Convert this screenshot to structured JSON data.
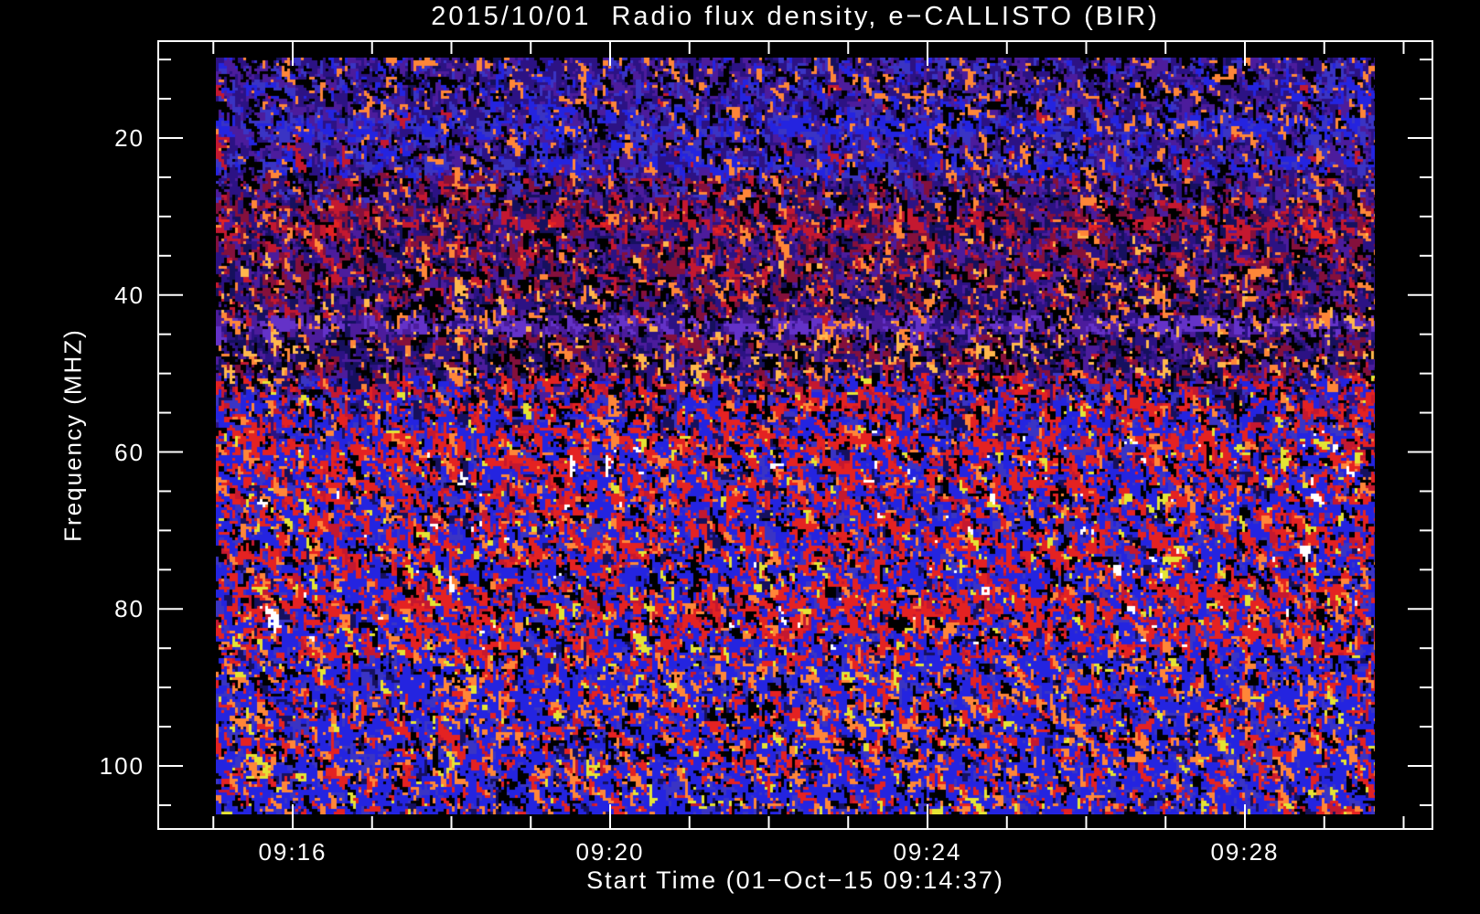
{
  "title": "2015/10/01  Radio flux density, e−CALLISTO (BIR)",
  "colors": {
    "background": "#000000",
    "foreground": "#ffffff"
  },
  "chart_data": {
    "type": "heatmap",
    "subtype": "radio-spectrogram",
    "title": "2015/10/01  Radio flux density, e−CALLISTO (BIR)",
    "xlabel": "Start Time (01−Oct−15 09:14:37)",
    "ylabel": "Frequency (MHZ)",
    "instrument": "e−CALLISTO (BIR)",
    "date": "2015/10/01",
    "start_time": "09:14:37",
    "x_ticks": [
      {
        "label": "09:16",
        "minute": 0
      },
      {
        "label": "09:20",
        "minute": 4
      },
      {
        "label": "09:24",
        "minute": 8
      },
      {
        "label": "09:28",
        "minute": 12
      }
    ],
    "x_minor_step_minutes": 1,
    "x_axis_range": [
      "09:14:18",
      "09:30:22"
    ],
    "y_ticks": [
      20,
      40,
      60,
      80,
      100
    ],
    "y_minor_step_mhz": 5,
    "y_axis_range_mhz": [
      7.5,
      108.1
    ],
    "y_axis_inverted": true,
    "grid": false,
    "legend": "none",
    "palette": {
      "K": "#000000",
      "NB": "#16105e",
      "IN": "#2c1284",
      "PU": "#4c1c9c",
      "VI": "#6432c8",
      "BL": "#2424e0",
      "MB": "#3a34c4",
      "MA": "#84103c",
      "CR": "#c41830",
      "RD": "#e42222",
      "OR": "#ff8638",
      "OY": "#ffb84c",
      "YL": "#e4e434",
      "WH": "#ffffff"
    },
    "noise_bands": [
      {
        "f0": 9.0,
        "f1": 13.0,
        "w": {
          "K": 20,
          "IN": 30,
          "PU": 20,
          "MB": 12,
          "BL": 8,
          "OR": 8,
          "NB": 2
        }
      },
      {
        "f0": 13.0,
        "f1": 17.0,
        "w": {
          "K": 18,
          "IN": 26,
          "PU": 18,
          "MB": 12,
          "BL": 14,
          "OR": 8,
          "CR": 2,
          "NB": 2
        }
      },
      {
        "f0": 17.0,
        "f1": 19.5,
        "w": {
          "K": 14,
          "IN": 16,
          "PU": 10,
          "MB": 18,
          "BL": 32,
          "OR": 8,
          "NB": 2
        }
      },
      {
        "f0": 19.5,
        "f1": 22.5,
        "w": {
          "K": 18,
          "IN": 24,
          "PU": 20,
          "MB": 12,
          "BL": 12,
          "OR": 8,
          "CR": 4,
          "NB": 2
        }
      },
      {
        "f0": 22.5,
        "f1": 24.5,
        "w": {
          "K": 14,
          "IN": 18,
          "PU": 12,
          "MB": 16,
          "BL": 28,
          "OR": 8,
          "CR": 2,
          "NB": 2
        }
      },
      {
        "f0": 24.5,
        "f1": 28.0,
        "w": {
          "K": 18,
          "IN": 22,
          "PU": 18,
          "MA": 12,
          "CR": 6,
          "MB": 8,
          "OR": 8,
          "NB": 8
        }
      },
      {
        "f0": 28.0,
        "f1": 30.5,
        "w": {
          "K": 16,
          "MA": 20,
          "CR": 14,
          "IN": 18,
          "PU": 14,
          "NB": 8,
          "OR": 8,
          "MB": 2
        }
      },
      {
        "f0": 30.5,
        "f1": 31.8,
        "w": {
          "K": 8,
          "CR": 30,
          "RD": 6,
          "NB": 24,
          "IN": 12,
          "MA": 8,
          "OR": 8,
          "PU": 4
        }
      },
      {
        "f0": 31.8,
        "f1": 38.0,
        "w": {
          "K": 16,
          "NB": 12,
          "IN": 16,
          "PU": 18,
          "MA": 18,
          "CR": 10,
          "OR": 8,
          "OY": 2
        }
      },
      {
        "f0": 38.0,
        "f1": 42.5,
        "w": {
          "K": 20,
          "NB": 16,
          "IN": 18,
          "PU": 16,
          "MA": 14,
          "CR": 6,
          "OR": 8,
          "OY": 2
        }
      },
      {
        "f0": 42.5,
        "f1": 44.6,
        "w": {
          "K": 10,
          "VI": 38,
          "PU": 22,
          "IN": 10,
          "NB": 4,
          "OR": 12,
          "OY": 4
        }
      },
      {
        "f0": 44.6,
        "f1": 50.0,
        "w": {
          "K": 22,
          "NB": 18,
          "IN": 18,
          "PU": 14,
          "MA": 12,
          "OR": 8,
          "OY": 6,
          "CR": 2
        }
      },
      {
        "f0": 50.0,
        "f1": 53.0,
        "w": {
          "K": 16,
          "NB": 10,
          "IN": 8,
          "PU": 8,
          "CR": 12,
          "RD": 12,
          "BL": 18,
          "MB": 8,
          "OR": 6,
          "YL": 2
        }
      },
      {
        "f0": 53.0,
        "f1": 57.0,
        "w": {
          "K": 12,
          "RD": 22,
          "CR": 8,
          "BL": 28,
          "MB": 10,
          "NB": 8,
          "IN": 4,
          "OR": 6,
          "YL": 2
        }
      },
      {
        "f0": 57.0,
        "f1": 86.0,
        "w": {
          "K": 10,
          "RD": 27,
          "CR": 5,
          "BL": 34,
          "MB": 9,
          "NB": 5,
          "OR": 6,
          "YL": 3,
          "WH": 1
        }
      },
      {
        "f0": 86.0,
        "f1": 108.2,
        "w": {
          "K": 10,
          "RD": 14,
          "OR": 12,
          "BL": 44,
          "MB": 10,
          "NB": 5,
          "CR": 2,
          "YL": 3
        }
      }
    ],
    "noise_description": "random speckle spectrogram; dark purple/maroon above ~52 MHz boundary, bright blue/red noise below; bright violet stripe near 43-44 MHz, red/navy stripe near 31 MHz, brighter blue stripes near 18 and 23 MHz"
  }
}
